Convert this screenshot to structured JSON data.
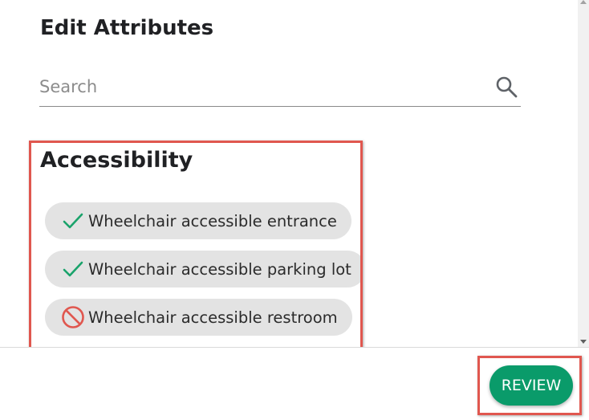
{
  "dialog": {
    "title": "Edit Attributes"
  },
  "search": {
    "placeholder": "Search",
    "value": "",
    "icon": "search-icon"
  },
  "section": {
    "title": "Accessibility",
    "items": [
      {
        "label": "Wheelchair accessible entrance",
        "state": "yes",
        "icon": "check-icon"
      },
      {
        "label": "Wheelchair accessible parking lot",
        "state": "yes",
        "icon": "check-icon"
      },
      {
        "label": "Wheelchair accessible restroom",
        "state": "no",
        "icon": "prohibited-icon"
      }
    ]
  },
  "footer": {
    "review_label": "REVIEW"
  },
  "colors": {
    "accent_green": "#0a9b6a",
    "check_green": "#1aa36b",
    "no_red": "#e0574f",
    "highlight_red": "#e0574f",
    "chip_bg": "#e3e3e3"
  }
}
